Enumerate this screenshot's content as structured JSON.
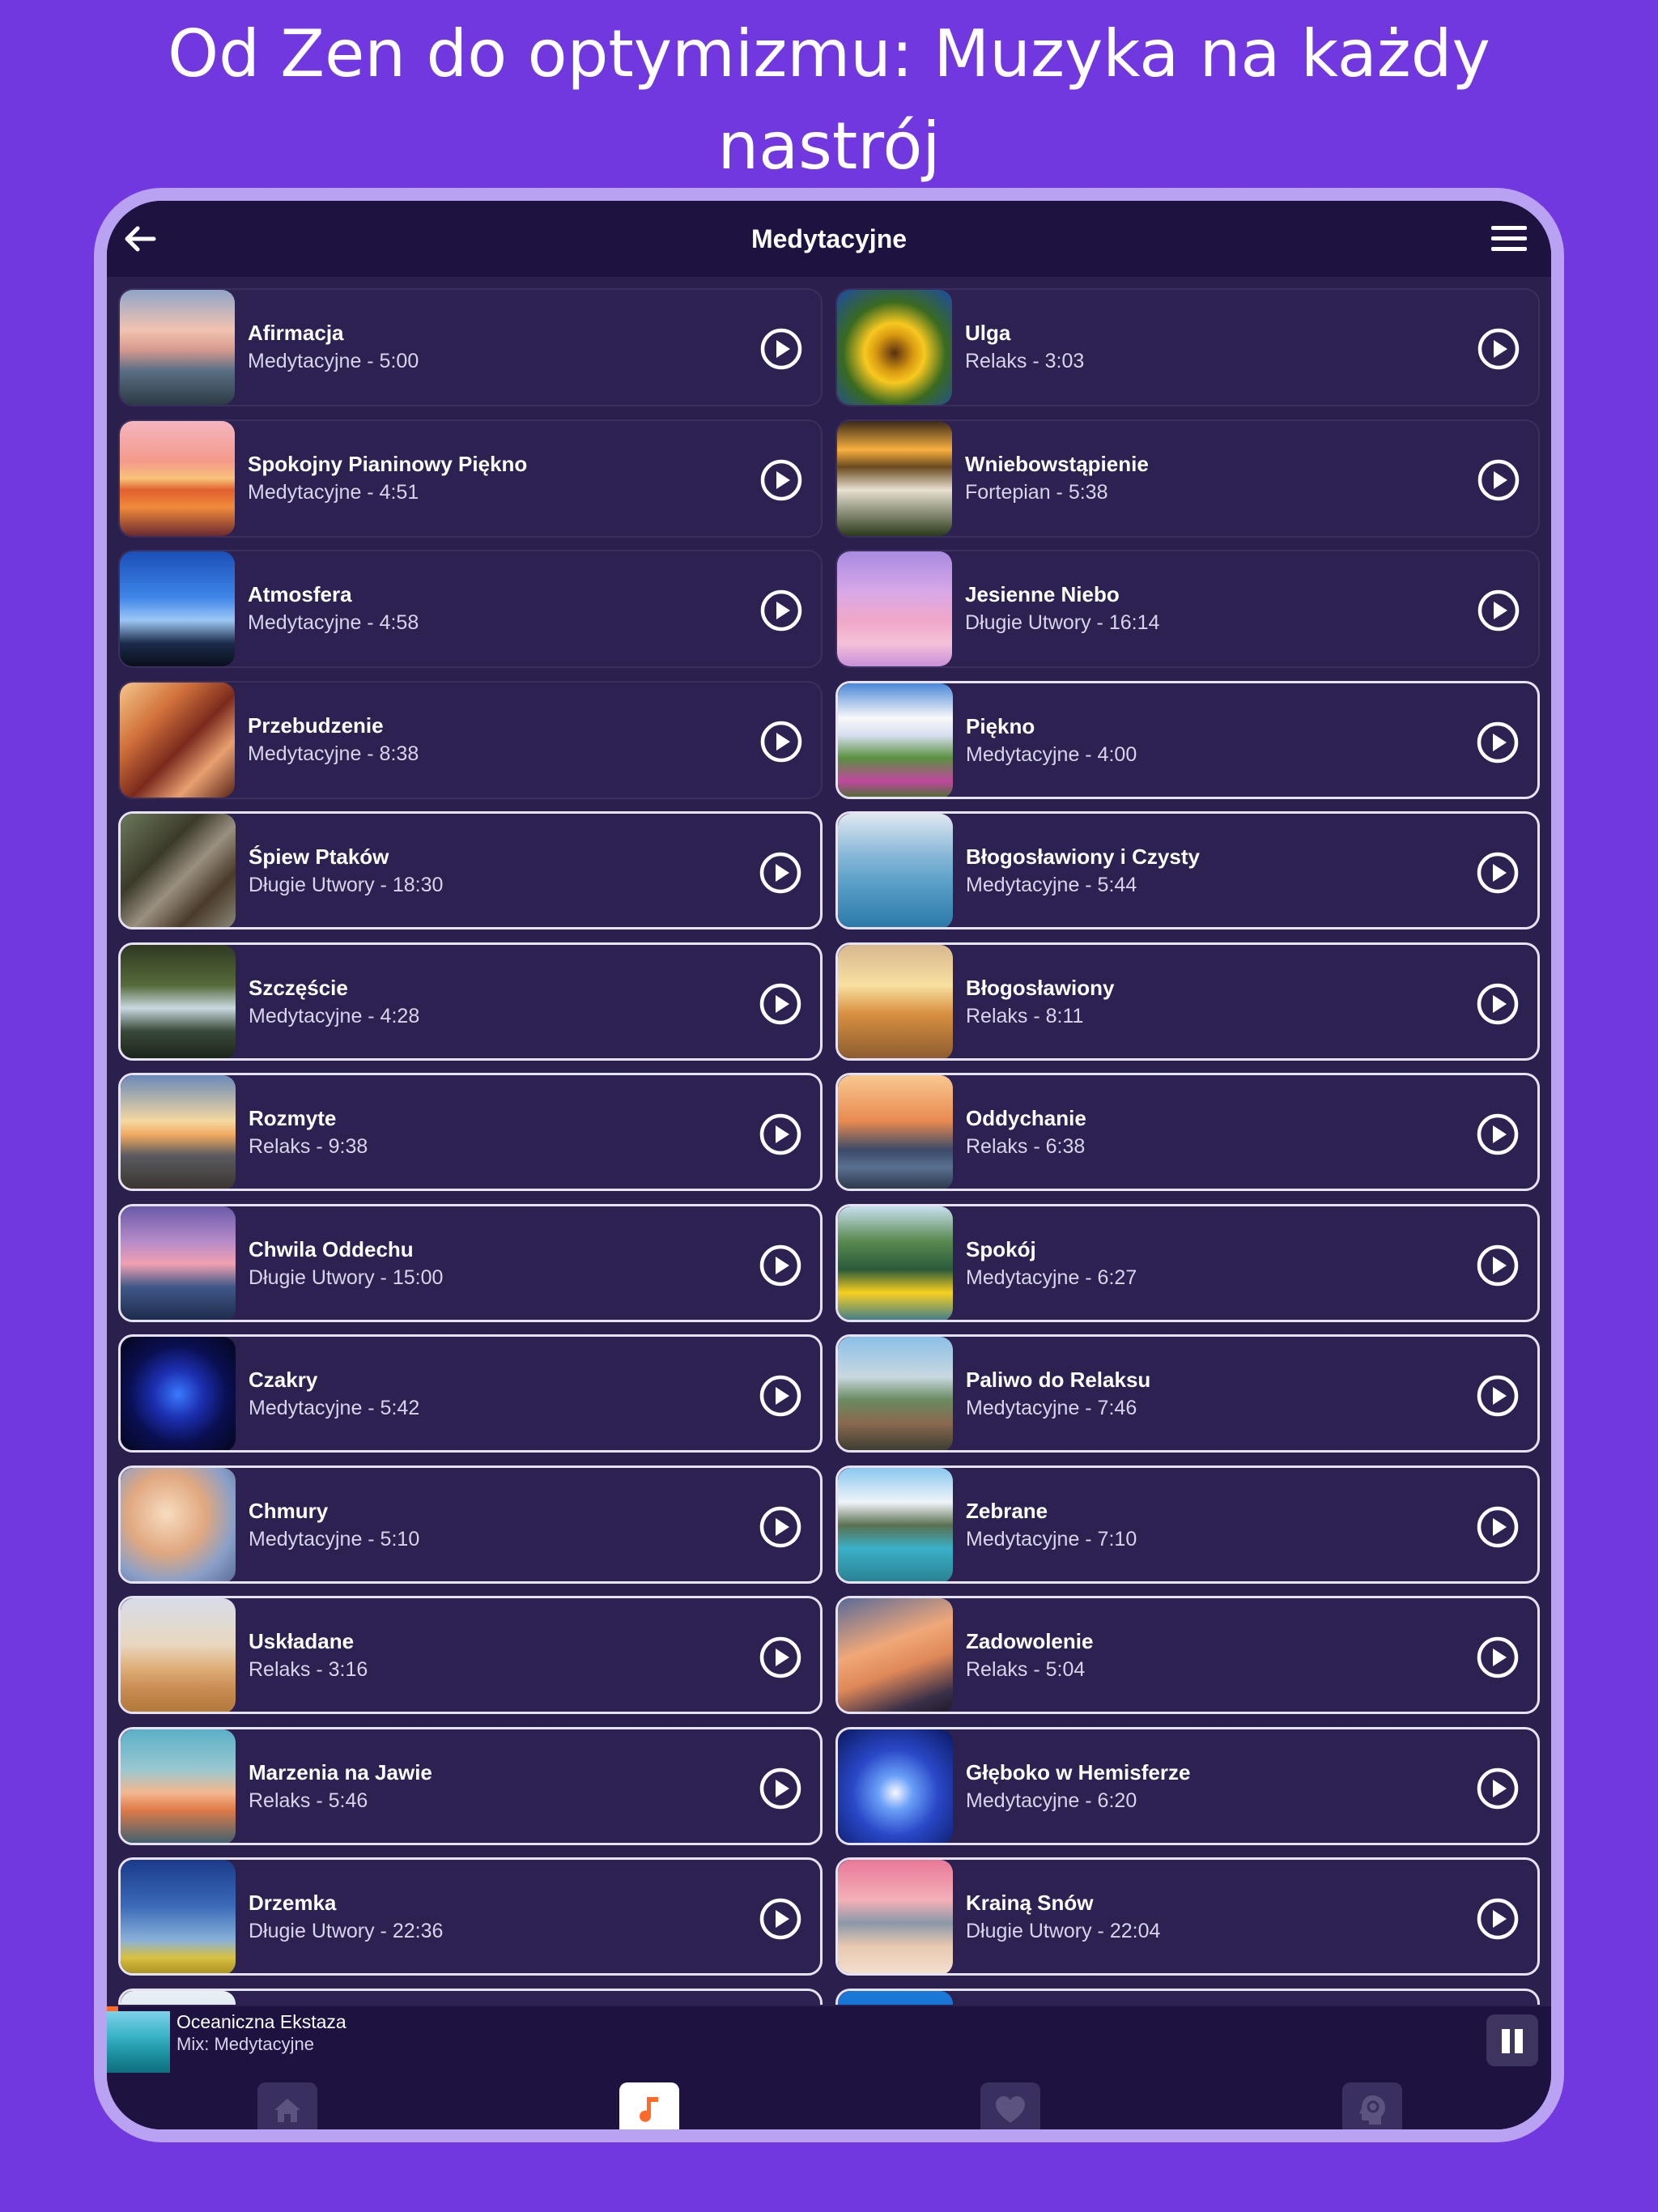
{
  "headline": {
    "line1": "Od Zen do optymizmu: Muzyka na każdy",
    "line2": "nastrój"
  },
  "navbar": {
    "title": "Medytacyjne",
    "back_icon": "arrow-left-icon",
    "menu_icon": "hamburger-menu-icon"
  },
  "tracks_left": [
    {
      "title": "Afirmacja",
      "subtitle": "Medytacyjne - 5:00"
    },
    {
      "title": "Spokojny Pianinowy Piękno",
      "subtitle": "Medytacyjne - 4:51"
    },
    {
      "title": "Atmosfera",
      "subtitle": "Medytacyjne - 4:58"
    },
    {
      "title": "Przebudzenie",
      "subtitle": "Medytacyjne - 8:38"
    },
    {
      "title": "Śpiew Ptaków",
      "subtitle": "Długie Utwory - 18:30"
    },
    {
      "title": "Szczęście",
      "subtitle": "Medytacyjne - 4:28"
    },
    {
      "title": "Rozmyte",
      "subtitle": "Relaks - 9:38"
    },
    {
      "title": "Chwila Oddechu",
      "subtitle": "Długie Utwory - 15:00"
    },
    {
      "title": "Czakry",
      "subtitle": "Medytacyjne - 5:42"
    },
    {
      "title": "Chmury",
      "subtitle": "Medytacyjne - 5:10"
    },
    {
      "title": "Uskładane",
      "subtitle": "Relaks - 3:16"
    },
    {
      "title": "Marzenia na Jawie",
      "subtitle": "Relaks - 5:46"
    },
    {
      "title": "Drzemka",
      "subtitle": "Długie Utwory - 22:36"
    }
  ],
  "tracks_right": [
    {
      "title": "Ulga",
      "subtitle": "Relaks - 3:03"
    },
    {
      "title": "Wniebowstąpienie",
      "subtitle": "Fortepian - 5:38"
    },
    {
      "title": "Jesienne Niebo",
      "subtitle": "Długie Utwory - 16:14"
    },
    {
      "title": "Piękno",
      "subtitle": "Medytacyjne - 4:00"
    },
    {
      "title": "Błogosławiony i Czysty",
      "subtitle": "Medytacyjne - 5:44"
    },
    {
      "title": "Błogosławiony",
      "subtitle": "Relaks - 8:11"
    },
    {
      "title": "Oddychanie",
      "subtitle": "Relaks - 6:38"
    },
    {
      "title": "Spokój",
      "subtitle": "Medytacyjne - 6:27"
    },
    {
      "title": "Paliwo do Relaksu",
      "subtitle": "Medytacyjne - 7:46"
    },
    {
      "title": "Zebrane",
      "subtitle": "Medytacyjne - 7:10"
    },
    {
      "title": "Zadowolenie",
      "subtitle": "Relaks - 5:04"
    },
    {
      "title": "Głęboko w Hemisferze",
      "subtitle": "Medytacyjne - 6:20"
    },
    {
      "title": "Krainą Snów",
      "subtitle": "Długie Utwory - 22:04"
    }
  ],
  "now_playing": {
    "title": "Oceaniczna Ekstaza",
    "subtitle": "Mix: Medytacyjne",
    "pause_icon": "pause-icon"
  },
  "tabbar": {
    "tabs": [
      {
        "icon": "home-icon",
        "active": false
      },
      {
        "icon": "music-note-icon",
        "active": true
      },
      {
        "icon": "heart-icon",
        "active": false
      },
      {
        "icon": "head-gear-icon",
        "active": false
      }
    ]
  },
  "colors": {
    "background": "#7238e0",
    "device_frame": "#b9a2f2",
    "screen": "#2a1f4d",
    "bar": "#1e1240",
    "accent": "#ff6a2a"
  }
}
